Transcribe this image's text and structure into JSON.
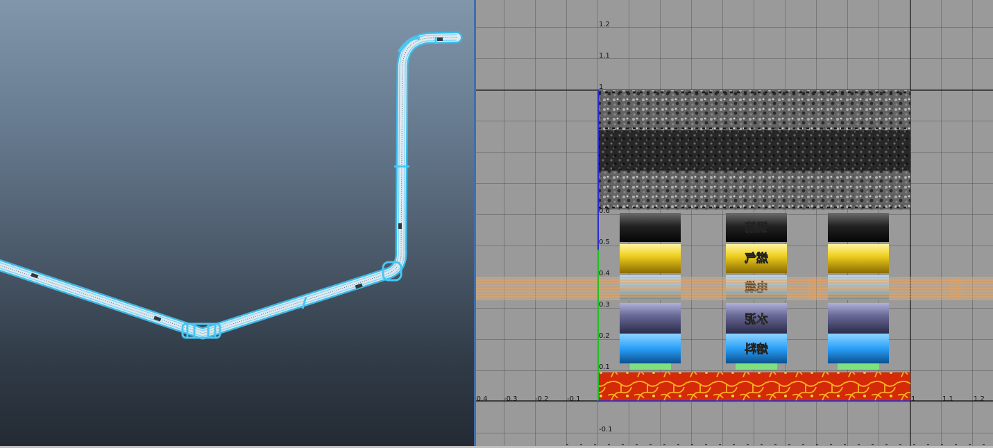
{
  "viewport_3d": {
    "object": "pipe-mesh",
    "wire_color": "#5fd0f0"
  },
  "uv_editor": {
    "grid": true,
    "x_ticks": [
      "-0.4",
      "-0.3",
      "-0.2",
      "-0.1",
      "1",
      "1.1",
      "1.2"
    ],
    "y_ticks": [
      "1.2",
      "1.1",
      "1",
      "0.6",
      "0.5",
      "0.4",
      "0.3",
      "0.2",
      "0.1",
      "-0.1"
    ],
    "texture_labels": [
      "钢筋",
      "燃气",
      "电缆",
      "水泥",
      "熔料"
    ],
    "colors": {
      "background": "#9a9a9a",
      "grid": "#555555",
      "selection": "#f0a050",
      "u_axis": "#2a2ad0",
      "v_axis": "#20c020"
    }
  }
}
